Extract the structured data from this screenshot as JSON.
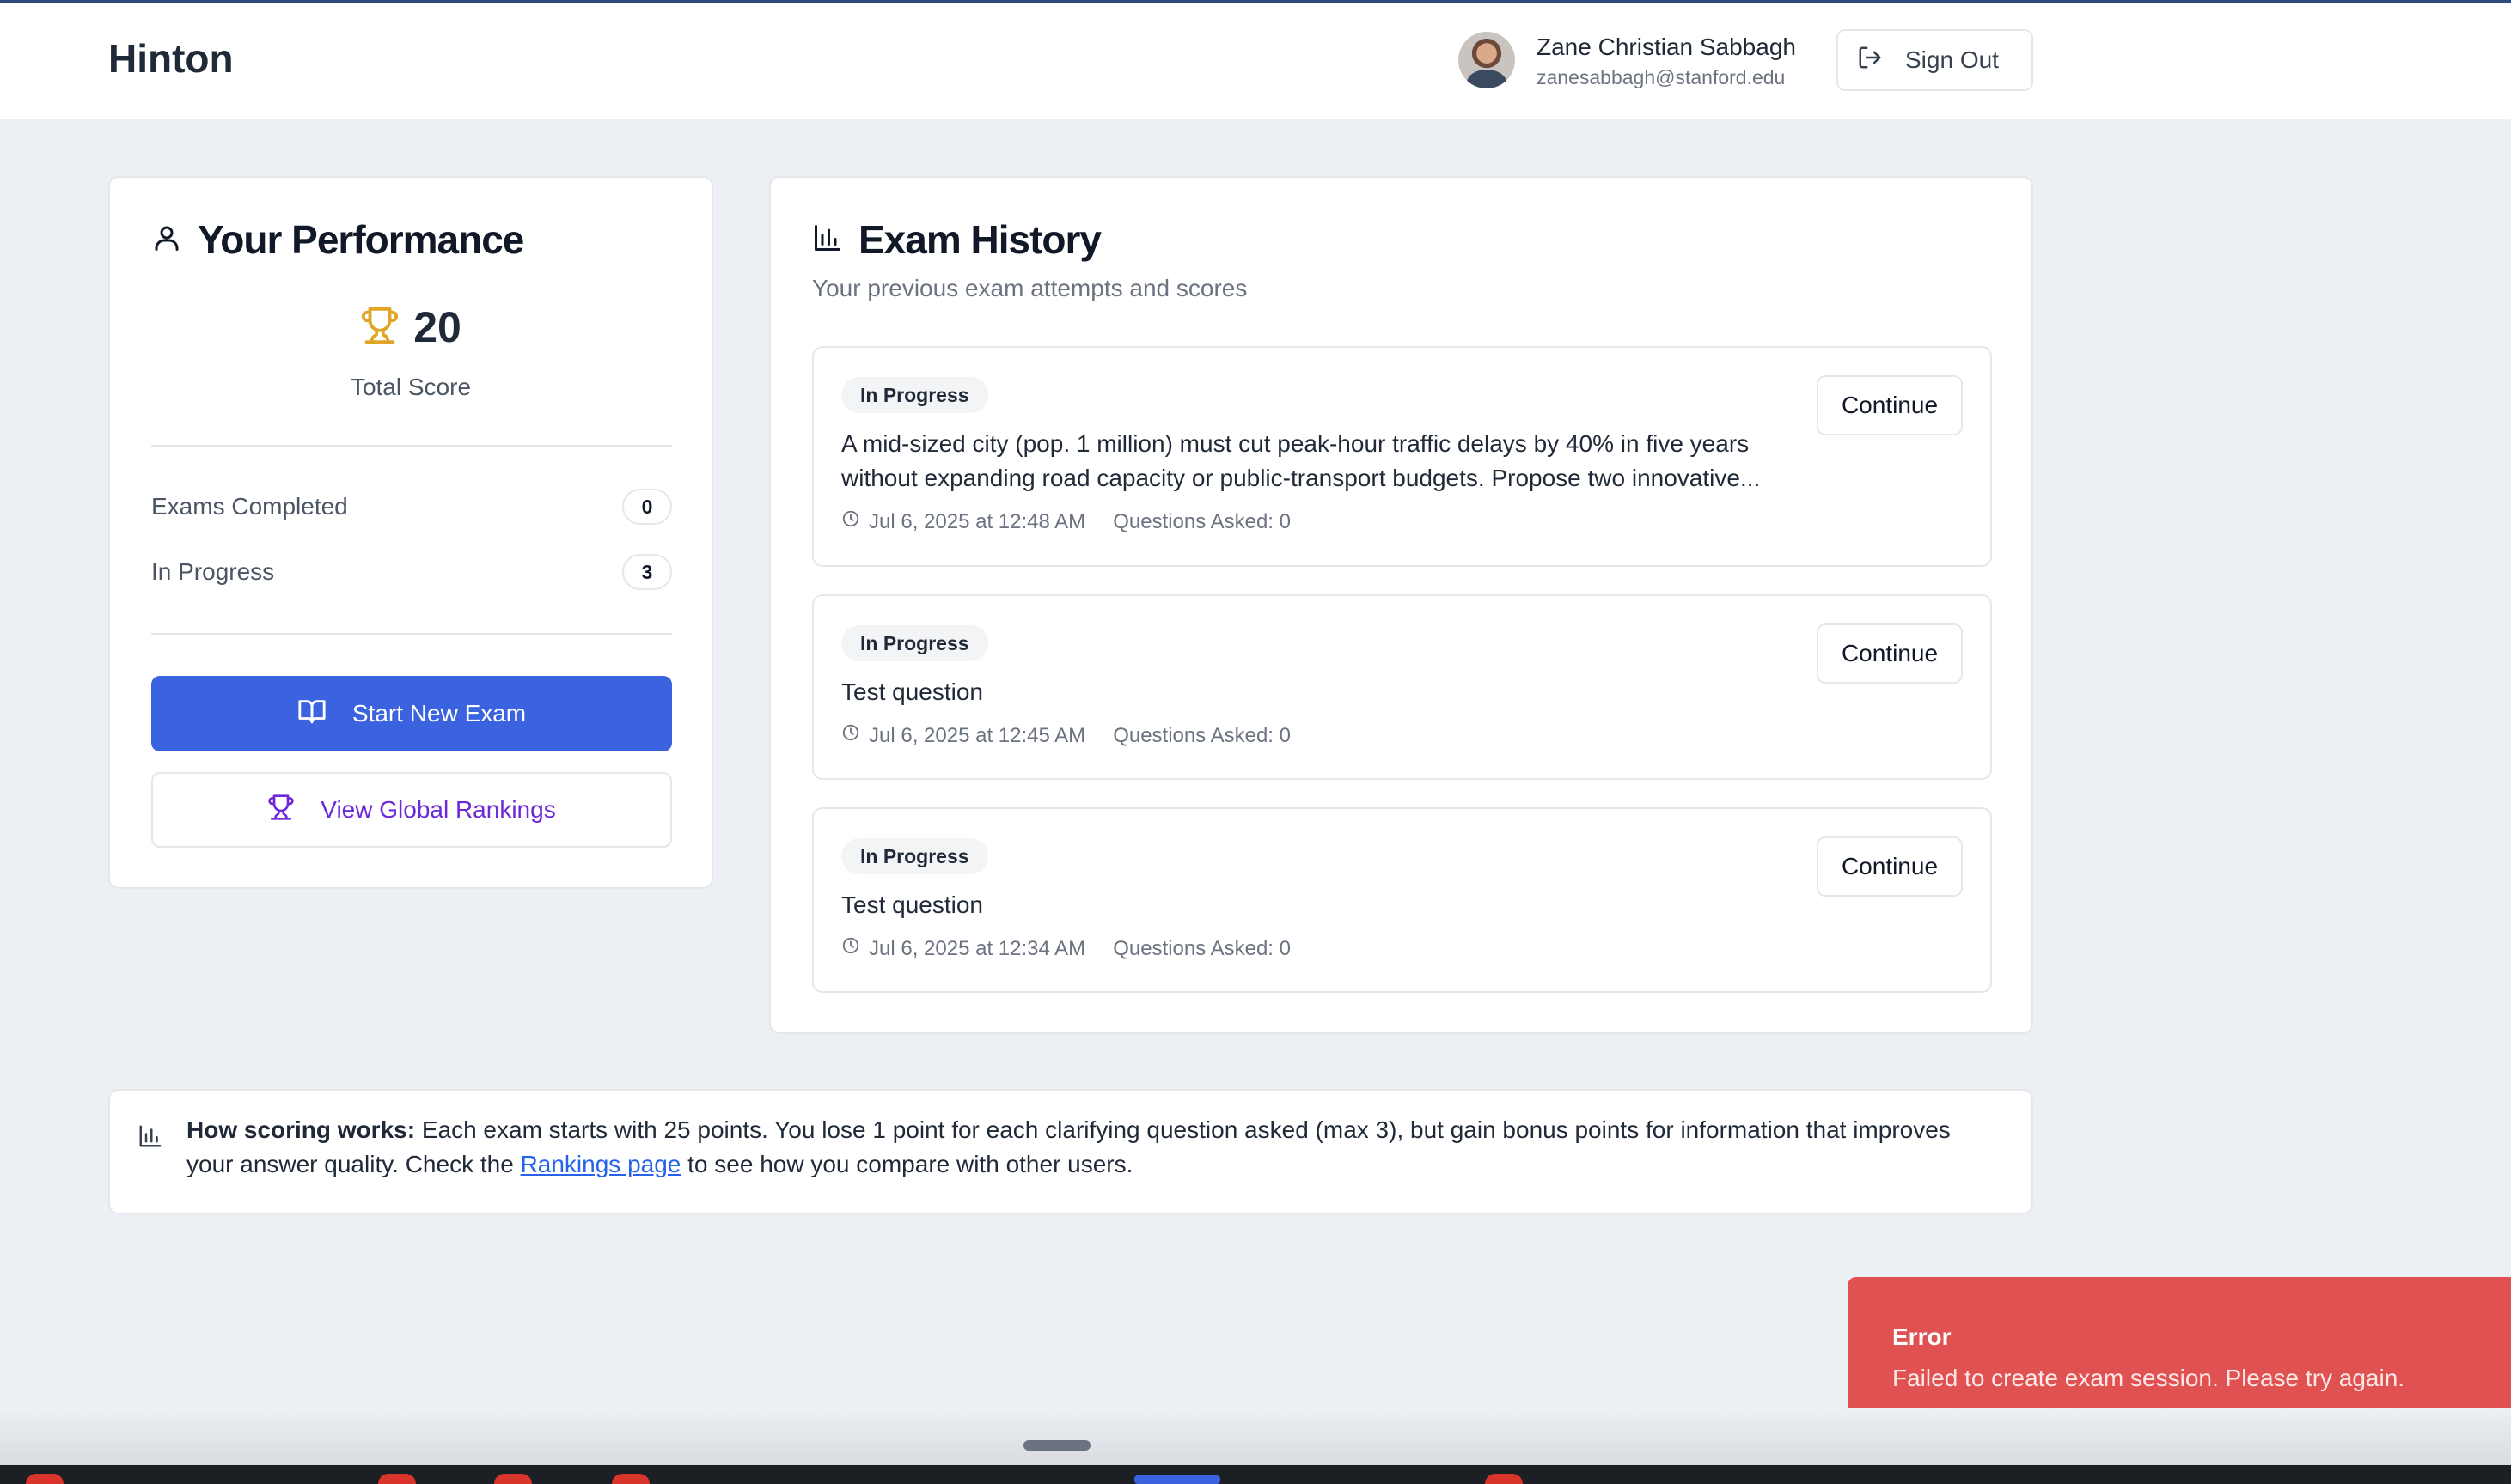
{
  "app": {
    "brand": "Hinton"
  },
  "user": {
    "name": "Zane Christian Sabbagh",
    "email": "zanesabbagh@stanford.edu",
    "signout_label": "Sign Out"
  },
  "performance": {
    "title": "Your Performance",
    "total_score": "20",
    "total_score_label": "Total Score",
    "exams_completed_label": "Exams Completed",
    "exams_completed": "0",
    "in_progress_label": "In Progress",
    "in_progress": "3",
    "start_button": "Start New Exam",
    "rankings_button": "View Global Rankings"
  },
  "history": {
    "title": "Exam History",
    "subtitle": "Your previous exam attempts and scores",
    "exams": [
      {
        "status": "In Progress",
        "text": "A mid-sized city (pop. 1 million) must cut peak-hour traffic delays by 40% in five years without expanding road capacity or public-transport budgets. Propose two innovative...",
        "date": "Jul 6, 2025 at 12:48 AM",
        "questions": "Questions Asked: 0",
        "action": "Continue"
      },
      {
        "status": "In Progress",
        "text": "Test question",
        "date": "Jul 6, 2025 at 12:45 AM",
        "questions": "Questions Asked: 0",
        "action": "Continue"
      },
      {
        "status": "In Progress",
        "text": "Test question",
        "date": "Jul 6, 2025 at 12:34 AM",
        "questions": "Questions Asked: 0",
        "action": "Continue"
      }
    ]
  },
  "scoring_note": {
    "heading": "How scoring works:",
    "body": " Each exam starts with 25 points. You lose 1 point for each clarifying question asked (max 3), but gain bonus points for information that improves your answer quality. Check the ",
    "link": "Rankings page",
    "tail": " to see how you compare with other users."
  },
  "toast": {
    "title": "Error",
    "message": "Failed to create exam session. Please try again."
  },
  "colors": {
    "primary": "#3b63e0",
    "error": "#e05252",
    "trophy": "#e0a526",
    "rankings": "#6d28d9"
  }
}
